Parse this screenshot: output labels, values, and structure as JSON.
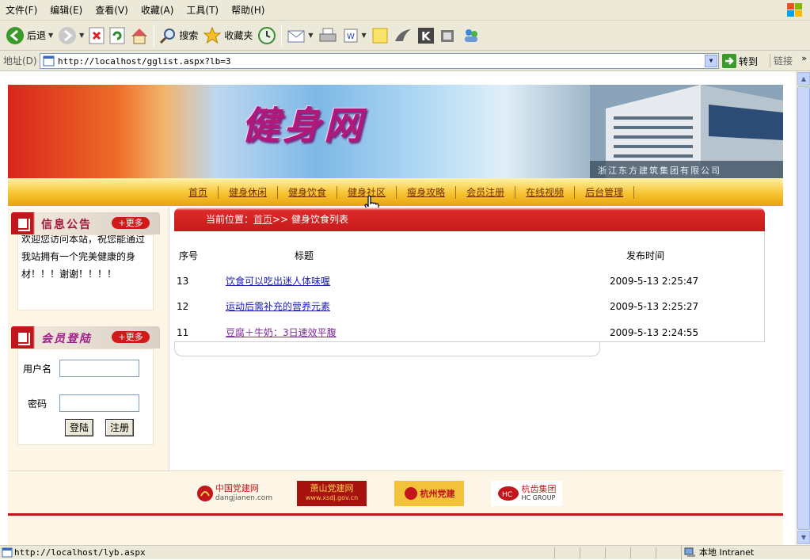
{
  "browser": {
    "menu": [
      "文件(F)",
      "编辑(E)",
      "查看(V)",
      "收藏(A)",
      "工具(T)",
      "帮助(H)"
    ],
    "toolbar": {
      "back": "后退",
      "search": "搜索",
      "favorites": "收藏夹"
    },
    "address": {
      "label": "地址(D)",
      "url": "http://localhost/gglist.aspx?lb=3",
      "go": "转到",
      "links": "链接"
    },
    "status": {
      "url": "http://localhost/lyb.aspx",
      "zone": "本地 Intranet"
    }
  },
  "site": {
    "title": "健身网",
    "company": "浙江东方建筑集团有限公司",
    "nav": [
      "首页",
      "健身休闲",
      "健身饮食",
      "健身社区",
      "瘦身攻略",
      "会员注册",
      "在线视频",
      "后台管理"
    ],
    "notice": {
      "title": "信息公告",
      "more": "更多",
      "text": "欢迎您访问本站，祝您能通过我站拥有一个完美健康的身材！！！谢谢！！！！"
    },
    "login": {
      "title": "会员登陆",
      "more": "更多",
      "username_label": "用户名",
      "password_label": "密码",
      "login_button": "登陆",
      "register_button": "注册"
    },
    "breadcrumb": {
      "prefix": "当前位置：",
      "home": "首页",
      "current": ">> 健身饮食列表"
    },
    "table": {
      "headers": [
        "序号",
        "标题",
        "发布时间"
      ],
      "rows": [
        {
          "id": "13",
          "title": "饮食可以吃出迷人体味喔",
          "time": "2009-5-13 2:25:47"
        },
        {
          "id": "12",
          "title": "运动后需补充的营养元素",
          "time": "2009-5-13 2:25:27"
        },
        {
          "id": "11",
          "title": "豆腐＋牛奶：3日速效平腹",
          "time": "2009-5-13 2:24:55"
        }
      ]
    },
    "footer_links": [
      {
        "text": "中国党建网",
        "sub": "dangjianen.com",
        "color": "#c2161c"
      },
      {
        "text": "萧山党建网",
        "sub": "www.xsdj.gov.cn",
        "color": "#f6d04a"
      },
      {
        "text": "杭州党建",
        "sub": "",
        "color": "#c2161c"
      },
      {
        "text": "杭齿集团",
        "sub": "HC GROUP",
        "color": "#c2161c"
      }
    ]
  }
}
